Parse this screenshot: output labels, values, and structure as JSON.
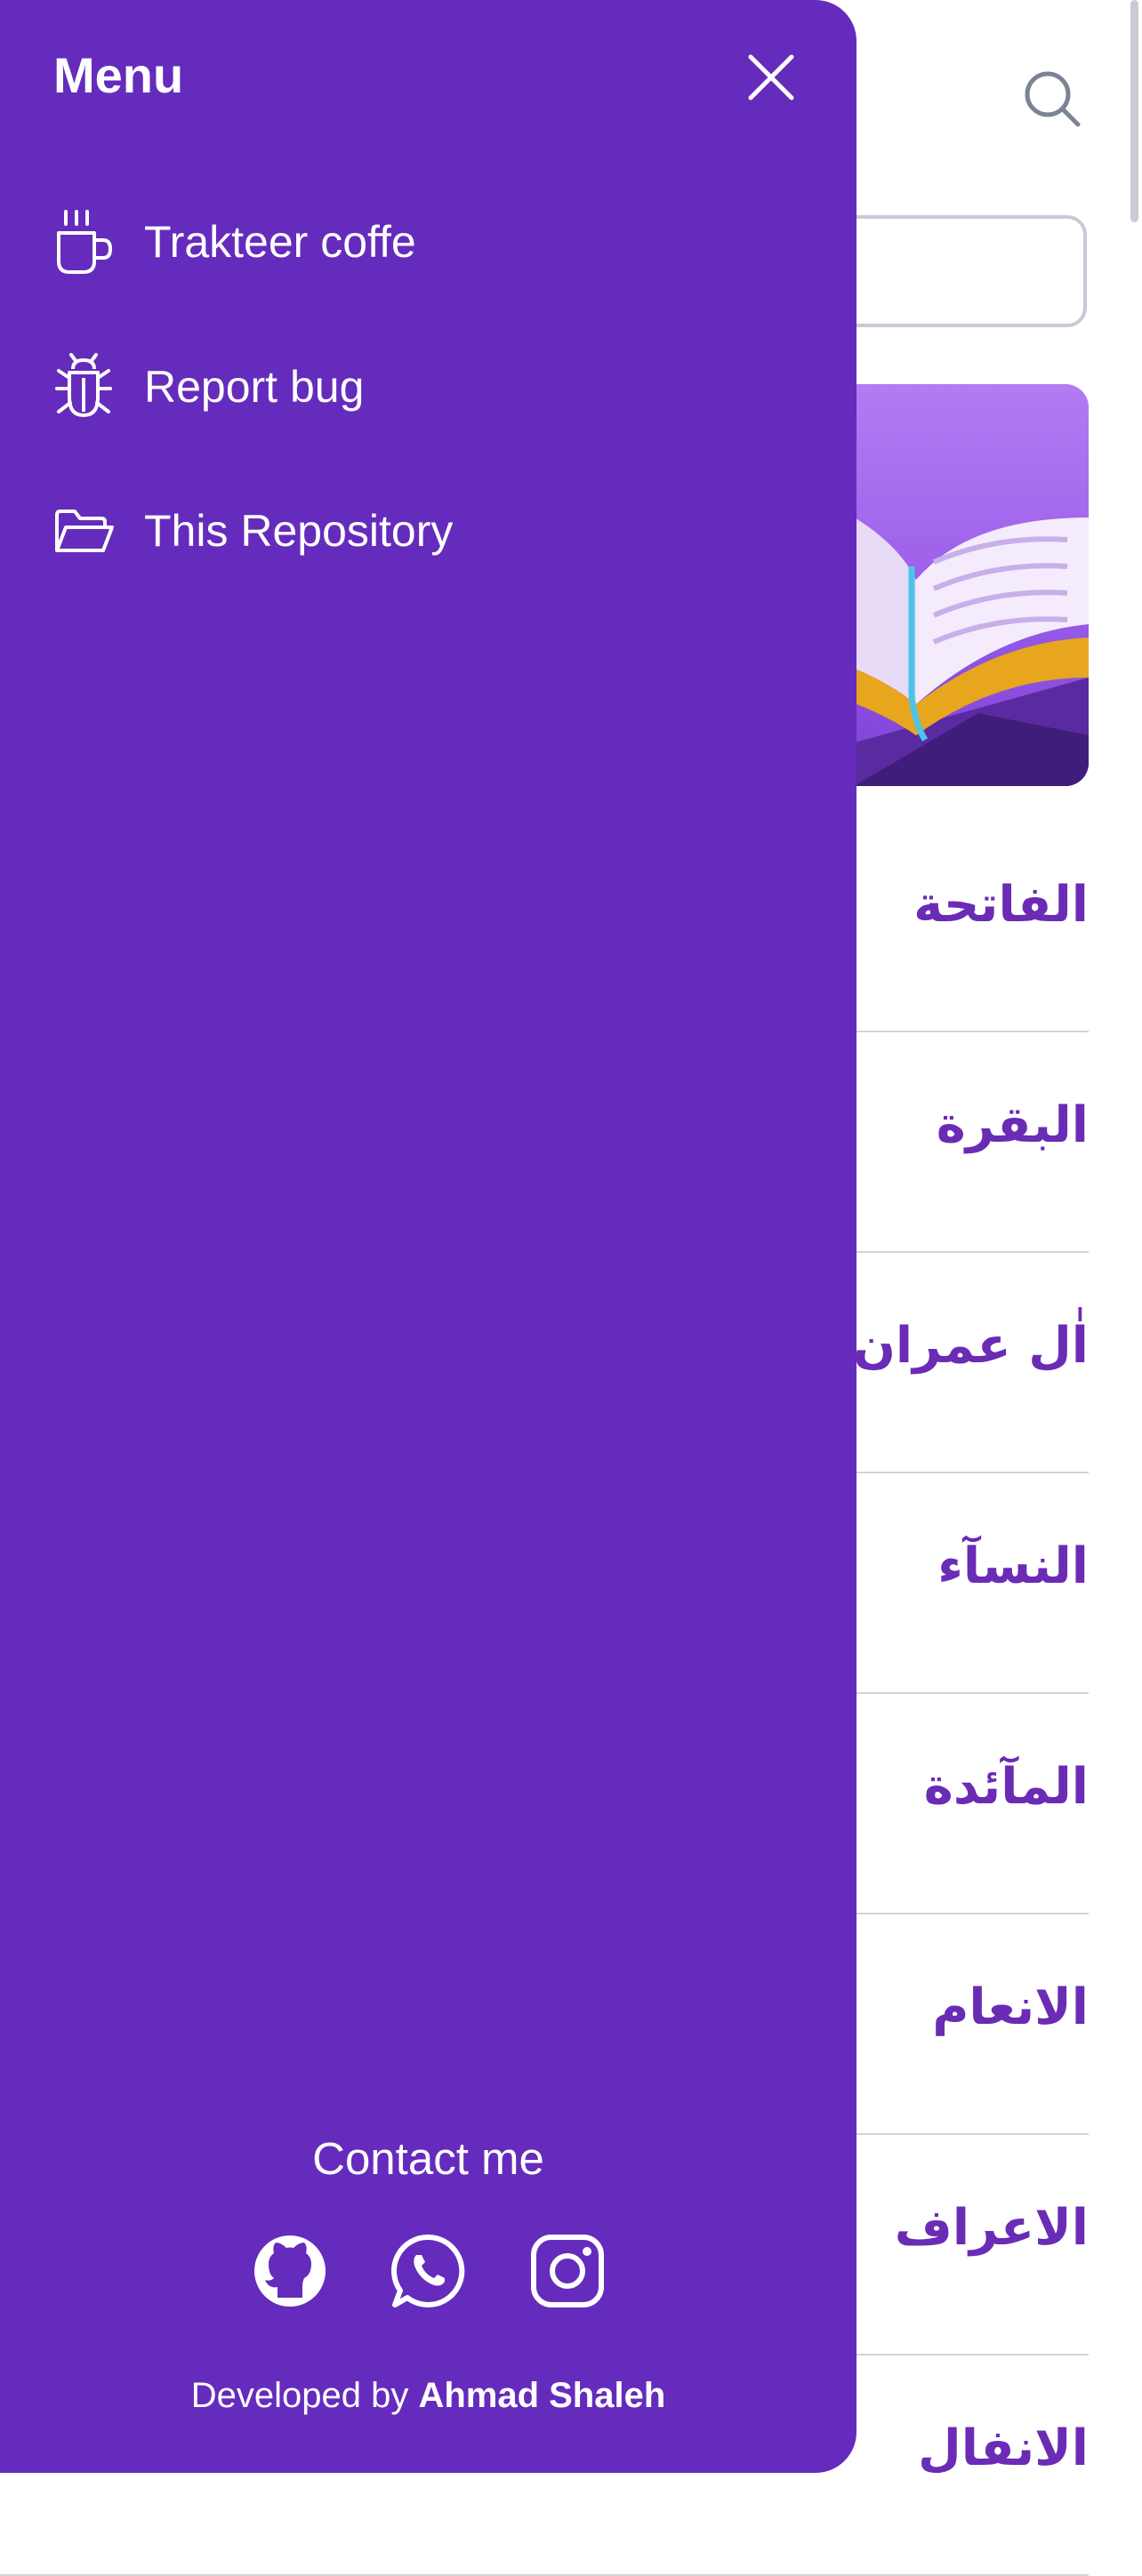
{
  "background_page": {
    "search_placeholder": "",
    "surahs": [
      {
        "name": "الفاتحة"
      },
      {
        "name": "البقرة"
      },
      {
        "name": "اٰل عمران"
      },
      {
        "name": "النسآء"
      },
      {
        "name": "المآئدة"
      },
      {
        "name": "الانعام"
      },
      {
        "name": "الاعراف"
      },
      {
        "name": "الانفال"
      }
    ]
  },
  "drawer": {
    "title": "Menu",
    "items": [
      {
        "label": "Trakteer coffe",
        "icon": "coffee-cup-icon"
      },
      {
        "label": "Report bug",
        "icon": "bug-icon"
      },
      {
        "label": "This Repository",
        "icon": "folder-open-icon"
      }
    ],
    "contact": {
      "title": "Contact me",
      "links": [
        {
          "icon": "github-icon"
        },
        {
          "icon": "whatsapp-icon"
        },
        {
          "icon": "instagram-icon"
        }
      ]
    },
    "footer": {
      "prefix": "Developed by",
      "author": "Ahmad Shaleh"
    }
  },
  "colors": {
    "drawer_bg": "#652bbd",
    "accent_text": "#6a2bb5",
    "divider": "#cfd5de"
  }
}
